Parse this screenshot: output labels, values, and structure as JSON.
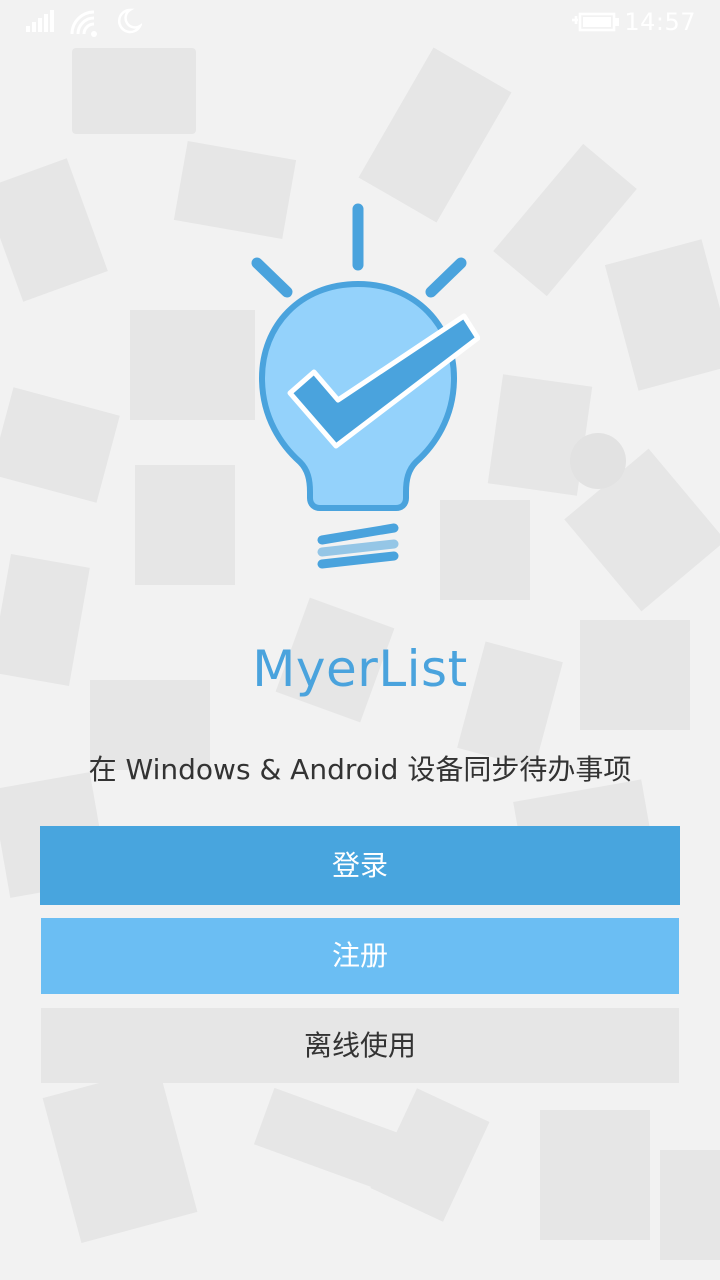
{
  "status_bar": {
    "time": "14:57",
    "icons": [
      "signal-icon",
      "wifi-icon",
      "moon-icon",
      "battery-charging-icon"
    ]
  },
  "app": {
    "title": "MyerList",
    "tagline": "在 Windows & Android 设备同步待办事项",
    "logo_icon": "lightbulb-check-icon"
  },
  "buttons": {
    "login": "登录",
    "register": "注册",
    "offline": "离线使用"
  },
  "colors": {
    "accent": "#48a5de",
    "accent_light": "#6bbef3",
    "title": "#4aa3dd",
    "neutral_button": "#e6e6e6",
    "background": "#f2f2f2"
  }
}
